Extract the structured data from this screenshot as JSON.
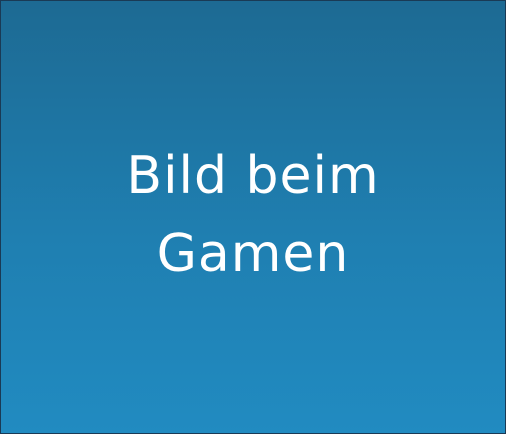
{
  "placeholder": {
    "line1": "Bild beim",
    "line2": "Gamen",
    "colors": {
      "gradient_top": "#1d6a93",
      "gradient_bottom": "#218bc1",
      "text": "#ffffff",
      "border": "#1a3a55"
    }
  }
}
